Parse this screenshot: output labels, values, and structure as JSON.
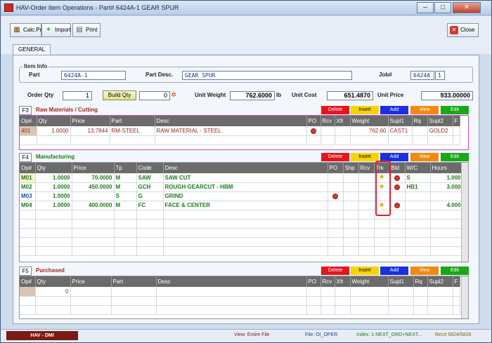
{
  "window": {
    "title": "HAV-Order Item Operations - Part# 6424A-1 GEAR SPUR"
  },
  "toolbar": {
    "calc": "Calc.Prc",
    "import": "Import",
    "print": "Print",
    "close": "Close"
  },
  "tabs": {
    "general": "GENERAL"
  },
  "item_info": {
    "group_label": "Item Info",
    "part_label": "Part",
    "part_value": "6424A-1",
    "desc_label": "Part Desc.",
    "desc_value": "GEAR SPUR",
    "job_label": "Job#",
    "job_value": "6424A",
    "job_suffix": "1",
    "order_qty_label": "Order Qty",
    "order_qty_value": "1",
    "build_qty_button": "Build Qty",
    "build_qty_value": "0",
    "unit_weight_label": "Unit Weight",
    "unit_weight_value": "762.6000",
    "unit_weight_unit": "lb",
    "unit_cost_label": "Unit Cost",
    "unit_cost_value": "651.4870",
    "unit_price_label": "Unit Price",
    "unit_price_value": "933.00000"
  },
  "actions": {
    "delete": "Delete",
    "insert": "Insert",
    "add": "Add",
    "view": "View",
    "edit": "Edit"
  },
  "raw": {
    "fkey": "F3",
    "title": "Raw Materials / Cutting",
    "columns": [
      "Op#",
      "Qty",
      "Price",
      "Part",
      "Desc",
      "PO",
      "Rcv",
      "Xfr",
      "Weight",
      "Supl1",
      "Rq",
      "Supl2",
      "F"
    ],
    "rows": [
      {
        "op": "401",
        "qty": "1.0000",
        "price": "13.7844",
        "part": "RM-STEEL",
        "desc": "RAW MATERIAL - STEEL",
        "weight": "762.60",
        "supl1": "CAST1",
        "supl2": "GOLD2"
      }
    ]
  },
  "mfg": {
    "fkey": "F4",
    "title": "Manufacturing",
    "columns": [
      "Op#",
      "Qty",
      "Price",
      "Tp",
      "Code",
      "Desc",
      "PO",
      "Shp",
      "Rcv",
      "Trk",
      "Bld",
      "W/C",
      "Hours"
    ],
    "rows": [
      {
        "op": "M01",
        "qty": "1.0000",
        "price": "70.0000",
        "tp": "M",
        "code": "SAW",
        "desc": "SAW CUT",
        "wc": "S",
        "hours": "1.000"
      },
      {
        "op": "M02",
        "qty": "1.0000",
        "price": "450.0000",
        "tp": "M",
        "code": "GCH",
        "desc": "ROUGH GEARCUT  - HBM",
        "wc": "HB1",
        "hours": "3.000"
      },
      {
        "op": "M03",
        "qty": "1.0000",
        "price": "",
        "tp": "S",
        "code": "G",
        "desc": "GRIND",
        "wc": "",
        "hours": ""
      },
      {
        "op": "M04",
        "qty": "1.0000",
        "price": "400.0000",
        "tp": "M",
        "code": "FC",
        "desc": "FACE & CENTER",
        "wc": "",
        "hours": "4.000"
      }
    ]
  },
  "purch": {
    "fkey": "F5",
    "title": "Purchased",
    "columns": [
      "Op#",
      "Qty",
      "Price",
      "Part",
      "Desc",
      "PO",
      "Rcv",
      "Xfr",
      "Weight",
      "Supl1",
      "Rq",
      "Supl2",
      "F"
    ],
    "rows": [
      {
        "qty": "0"
      }
    ]
  },
  "status": {
    "module": "HAV - DMI",
    "view": "View: Entire File",
    "file": "File: OI_OPER",
    "index": "Index: 1-NEXT_ORD+NEXT...",
    "rec": "Rec# 5824/5828"
  },
  "colors": {
    "delete": "#e8141c",
    "insert": "#f5d400",
    "add": "#1a2fe0",
    "view": "#f08a10",
    "edit": "#18a818",
    "raw_title": "#9b2a1e",
    "mfg_title": "#1f7a1f",
    "purch_title": "#9b2a1e"
  }
}
